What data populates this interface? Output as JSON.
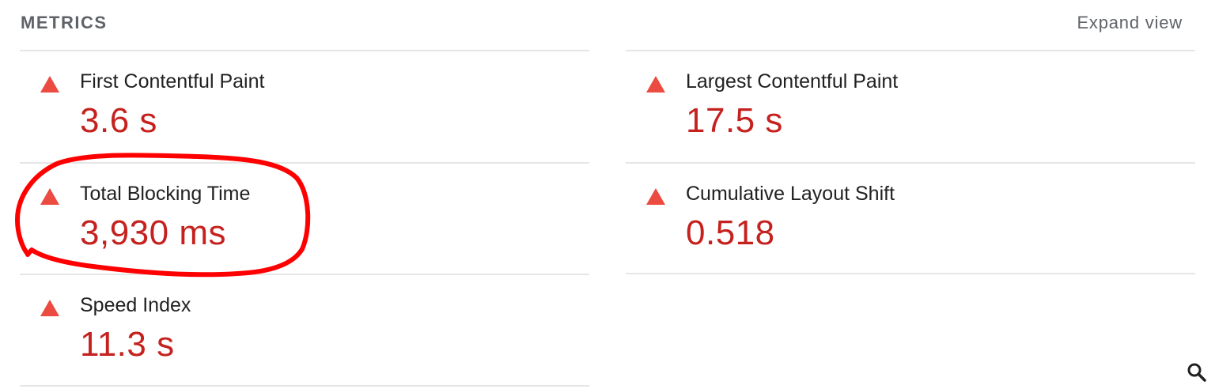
{
  "header": {
    "title": "METRICS",
    "expand_label": "Expand view"
  },
  "metrics": [
    {
      "label": "First Contentful Paint",
      "value": "3.6 s",
      "status": "fail"
    },
    {
      "label": "Largest Contentful Paint",
      "value": "17.5 s",
      "status": "fail"
    },
    {
      "label": "Total Blocking Time",
      "value": "3,930 ms",
      "status": "fail"
    },
    {
      "label": "Cumulative Layout Shift",
      "value": "0.518",
      "status": "fail"
    },
    {
      "label": "Speed Index",
      "value": "11.3 s",
      "status": "fail"
    }
  ],
  "icons": {
    "status": "fail-triangle-icon",
    "corner": "search-icon"
  },
  "colors": {
    "fail_icon": "#eb4b40",
    "fail_value": "#c5221f",
    "annotation": "#ff0000",
    "divider": "#e6e6e6",
    "header_text": "#5f6368"
  }
}
